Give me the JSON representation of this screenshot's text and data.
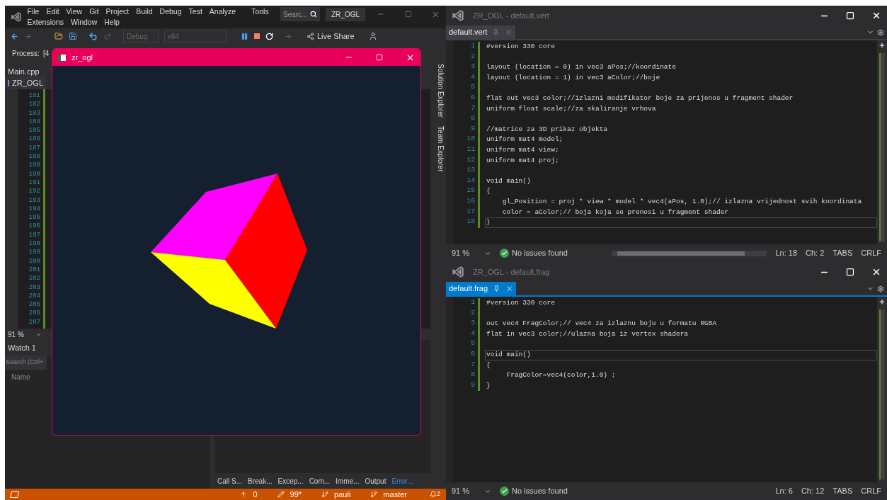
{
  "ide": {
    "menu": [
      "File",
      "Edit",
      "View",
      "Git",
      "Project",
      "Build",
      "Debug",
      "Test",
      "Analyze",
      "Tools",
      "Extensions",
      "Window",
      "Help"
    ],
    "search_placeholder": "Searc...",
    "solution_name": "ZR_OGL",
    "configuration": "Debug",
    "platform": "x64",
    "live_share": "Live Share",
    "process_label": "Process:",
    "process_value": "[4",
    "document_tab": "Main.cpp",
    "project": "ZR_OGL",
    "line_numbers": [
      "181",
      "182",
      "183",
      "184",
      "185",
      "186",
      "187",
      "188",
      "189",
      "190",
      "191",
      "192",
      "193",
      "194",
      "195",
      "196",
      "197",
      "198",
      "199",
      "200",
      "201",
      "202",
      "203",
      "204",
      "205",
      "206",
      "207"
    ],
    "zoom": "91 %",
    "watch": {
      "title": "Watch 1",
      "search_placeholder": "Search (Ctrl+",
      "column": "Name"
    },
    "side_tabs": [
      "Solution Explorer",
      "Team Explorer"
    ],
    "bottom_tabs": [
      {
        "label": "Call S...",
        "selected": false
      },
      {
        "label": "Break...",
        "selected": false
      },
      {
        "label": "Excep...",
        "selected": false
      },
      {
        "label": "Com...",
        "selected": false
      },
      {
        "label": "Imme...",
        "selected": false
      },
      {
        "label": "Output",
        "selected": false
      },
      {
        "label": "Error...",
        "selected": true
      }
    ],
    "status_bar": {
      "push_count": "0",
      "changes": "99*",
      "user": "pauli",
      "branch": "master",
      "notifications": "2"
    }
  },
  "app_window": {
    "title": "zr_ogl"
  },
  "editors": [
    {
      "title": "ZR_OGL - default.vert",
      "tab": {
        "label": "default.vert",
        "selected": false
      },
      "horizontal_scrollbar": true,
      "lines": [
        {
          "number": "1",
          "text": "#version 330 core",
          "current": false
        },
        {
          "number": "2",
          "current": false
        },
        {
          "number": "3",
          "text": "layout (location = 0) in vec3 aPos;//koordinate",
          "current": false
        },
        {
          "number": "4",
          "text": "layout (location = 1) in vec3 aColor;//boje",
          "current": false
        },
        {
          "number": "5",
          "current": false
        },
        {
          "number": "6",
          "text": "flat out vec3 color;//izlazni modifikator boje za prijenos u fragment shader",
          "current": false
        },
        {
          "number": "7",
          "text": "uniform float scale;//za skaliranje vrhova",
          "current": false
        },
        {
          "number": "8",
          "current": false
        },
        {
          "number": "9",
          "text": "//matrice za 3D prikaz objekta",
          "current": false
        },
        {
          "number": "10",
          "text": "uniform mat4 model;",
          "current": false
        },
        {
          "number": "11",
          "text": "uniform mat4 view;",
          "current": false
        },
        {
          "number": "12",
          "text": "uniform mat4 proj;",
          "current": false
        },
        {
          "number": "13",
          "current": false
        },
        {
          "number": "14",
          "text": "void main()",
          "current": false
        },
        {
          "number": "15",
          "text": "{",
          "current": false
        },
        {
          "number": "16",
          "text": "    gl_Position = proj * view * model * vec4(aPos, 1.0);// izlazna vrijednost svih koordinata",
          "current": false
        },
        {
          "number": "17",
          "text": "    color = aColor;// boja koja se prenosi u fragment shader",
          "current": false
        },
        {
          "number": "18",
          "text": "}",
          "current": true
        }
      ],
      "status": {
        "zoom": "91 %",
        "issues": "No issues found",
        "line": "Ln: 18",
        "column": "Ch: 2",
        "indent": "TABS",
        "line_ending": "CRLF"
      }
    },
    {
      "title": "ZR_OGL - default.frag",
      "tab": {
        "label": "default.frag",
        "selected": true
      },
      "horizontal_scrollbar": false,
      "lines": [
        {
          "number": "1",
          "text": "#version 330 core",
          "current": false
        },
        {
          "number": "2",
          "current": false
        },
        {
          "number": "3",
          "text": "out vec4 FragColor;// vec4 za izlaznu boju u formatu RGBA",
          "current": false
        },
        {
          "number": "4",
          "text": "flat in vec3 color;//ulazna boja iz vertex shadera",
          "current": false
        },
        {
          "number": "5",
          "current": false
        },
        {
          "number": "6",
          "text": "void main()",
          "current": true
        },
        {
          "number": "7",
          "text": "{",
          "current": false
        },
        {
          "number": "8",
          "text": "     FragColor=vec4(color,1.0) ;",
          "current": false
        },
        {
          "number": "9",
          "text": "}",
          "current": false
        }
      ],
      "status": {
        "zoom": "91 %",
        "issues": "No issues found",
        "line": "Ln: 6",
        "column": "Ch: 12",
        "indent": "TABS",
        "line_ending": "CRLF"
      }
    }
  ]
}
